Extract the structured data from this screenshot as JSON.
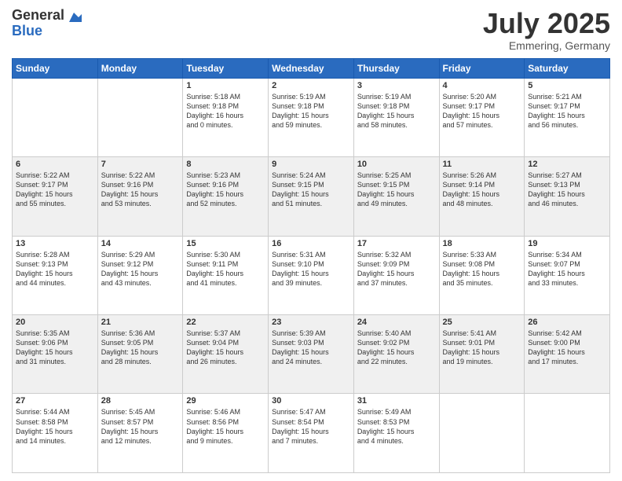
{
  "logo": {
    "general": "General",
    "blue": "Blue"
  },
  "title": "July 2025",
  "location": "Emmering, Germany",
  "days_of_week": [
    "Sunday",
    "Monday",
    "Tuesday",
    "Wednesday",
    "Thursday",
    "Friday",
    "Saturday"
  ],
  "weeks": [
    [
      {
        "day": "",
        "info": ""
      },
      {
        "day": "",
        "info": ""
      },
      {
        "day": "1",
        "info": "Sunrise: 5:18 AM\nSunset: 9:18 PM\nDaylight: 16 hours\nand 0 minutes."
      },
      {
        "day": "2",
        "info": "Sunrise: 5:19 AM\nSunset: 9:18 PM\nDaylight: 15 hours\nand 59 minutes."
      },
      {
        "day": "3",
        "info": "Sunrise: 5:19 AM\nSunset: 9:18 PM\nDaylight: 15 hours\nand 58 minutes."
      },
      {
        "day": "4",
        "info": "Sunrise: 5:20 AM\nSunset: 9:17 PM\nDaylight: 15 hours\nand 57 minutes."
      },
      {
        "day": "5",
        "info": "Sunrise: 5:21 AM\nSunset: 9:17 PM\nDaylight: 15 hours\nand 56 minutes."
      }
    ],
    [
      {
        "day": "6",
        "info": "Sunrise: 5:22 AM\nSunset: 9:17 PM\nDaylight: 15 hours\nand 55 minutes."
      },
      {
        "day": "7",
        "info": "Sunrise: 5:22 AM\nSunset: 9:16 PM\nDaylight: 15 hours\nand 53 minutes."
      },
      {
        "day": "8",
        "info": "Sunrise: 5:23 AM\nSunset: 9:16 PM\nDaylight: 15 hours\nand 52 minutes."
      },
      {
        "day": "9",
        "info": "Sunrise: 5:24 AM\nSunset: 9:15 PM\nDaylight: 15 hours\nand 51 minutes."
      },
      {
        "day": "10",
        "info": "Sunrise: 5:25 AM\nSunset: 9:15 PM\nDaylight: 15 hours\nand 49 minutes."
      },
      {
        "day": "11",
        "info": "Sunrise: 5:26 AM\nSunset: 9:14 PM\nDaylight: 15 hours\nand 48 minutes."
      },
      {
        "day": "12",
        "info": "Sunrise: 5:27 AM\nSunset: 9:13 PM\nDaylight: 15 hours\nand 46 minutes."
      }
    ],
    [
      {
        "day": "13",
        "info": "Sunrise: 5:28 AM\nSunset: 9:13 PM\nDaylight: 15 hours\nand 44 minutes."
      },
      {
        "day": "14",
        "info": "Sunrise: 5:29 AM\nSunset: 9:12 PM\nDaylight: 15 hours\nand 43 minutes."
      },
      {
        "day": "15",
        "info": "Sunrise: 5:30 AM\nSunset: 9:11 PM\nDaylight: 15 hours\nand 41 minutes."
      },
      {
        "day": "16",
        "info": "Sunrise: 5:31 AM\nSunset: 9:10 PM\nDaylight: 15 hours\nand 39 minutes."
      },
      {
        "day": "17",
        "info": "Sunrise: 5:32 AM\nSunset: 9:09 PM\nDaylight: 15 hours\nand 37 minutes."
      },
      {
        "day": "18",
        "info": "Sunrise: 5:33 AM\nSunset: 9:08 PM\nDaylight: 15 hours\nand 35 minutes."
      },
      {
        "day": "19",
        "info": "Sunrise: 5:34 AM\nSunset: 9:07 PM\nDaylight: 15 hours\nand 33 minutes."
      }
    ],
    [
      {
        "day": "20",
        "info": "Sunrise: 5:35 AM\nSunset: 9:06 PM\nDaylight: 15 hours\nand 31 minutes."
      },
      {
        "day": "21",
        "info": "Sunrise: 5:36 AM\nSunset: 9:05 PM\nDaylight: 15 hours\nand 28 minutes."
      },
      {
        "day": "22",
        "info": "Sunrise: 5:37 AM\nSunset: 9:04 PM\nDaylight: 15 hours\nand 26 minutes."
      },
      {
        "day": "23",
        "info": "Sunrise: 5:39 AM\nSunset: 9:03 PM\nDaylight: 15 hours\nand 24 minutes."
      },
      {
        "day": "24",
        "info": "Sunrise: 5:40 AM\nSunset: 9:02 PM\nDaylight: 15 hours\nand 22 minutes."
      },
      {
        "day": "25",
        "info": "Sunrise: 5:41 AM\nSunset: 9:01 PM\nDaylight: 15 hours\nand 19 minutes."
      },
      {
        "day": "26",
        "info": "Sunrise: 5:42 AM\nSunset: 9:00 PM\nDaylight: 15 hours\nand 17 minutes."
      }
    ],
    [
      {
        "day": "27",
        "info": "Sunrise: 5:44 AM\nSunset: 8:58 PM\nDaylight: 15 hours\nand 14 minutes."
      },
      {
        "day": "28",
        "info": "Sunrise: 5:45 AM\nSunset: 8:57 PM\nDaylight: 15 hours\nand 12 minutes."
      },
      {
        "day": "29",
        "info": "Sunrise: 5:46 AM\nSunset: 8:56 PM\nDaylight: 15 hours\nand 9 minutes."
      },
      {
        "day": "30",
        "info": "Sunrise: 5:47 AM\nSunset: 8:54 PM\nDaylight: 15 hours\nand 7 minutes."
      },
      {
        "day": "31",
        "info": "Sunrise: 5:49 AM\nSunset: 8:53 PM\nDaylight: 15 hours\nand 4 minutes."
      },
      {
        "day": "",
        "info": ""
      },
      {
        "day": "",
        "info": ""
      }
    ]
  ]
}
